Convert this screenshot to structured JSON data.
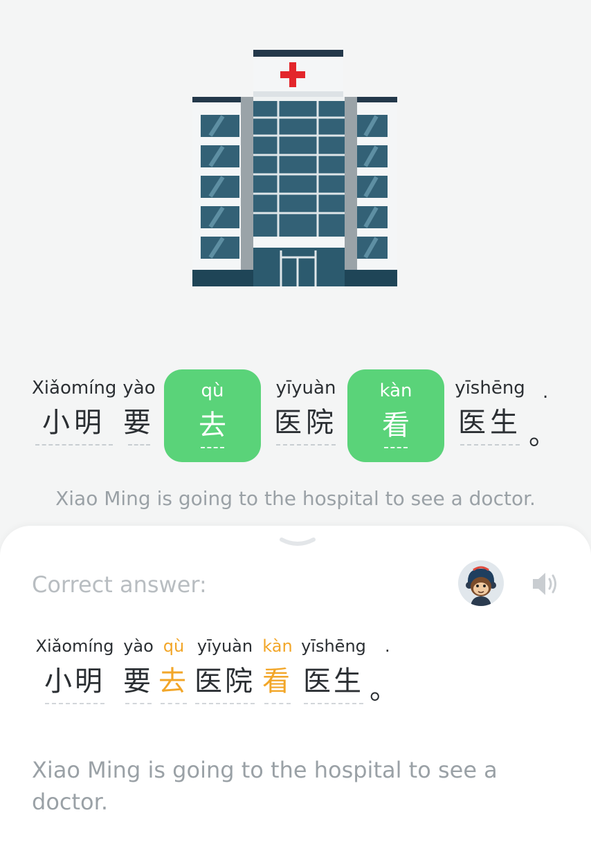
{
  "sentence": {
    "words": [
      {
        "pinyin": "Xiǎomíng",
        "hanzi": "小明"
      },
      {
        "pinyin": "yào",
        "hanzi": "要"
      },
      {
        "pinyin": "qù",
        "hanzi": "去",
        "selected": true
      },
      {
        "pinyin": "yīyuàn",
        "hanzi": "医院"
      },
      {
        "pinyin": "kàn",
        "hanzi": "看",
        "selected": true
      },
      {
        "pinyin": "yīshēng",
        "hanzi": "医生"
      }
    ],
    "period_pinyin": ".",
    "period_hanzi": "。"
  },
  "translation": "Xiao Ming is going to the hospital to see a doctor.",
  "answer": {
    "label": "Correct answer:",
    "words": [
      {
        "pinyin": "Xiǎomíng",
        "hanzi": "小明"
      },
      {
        "pinyin": "yào",
        "hanzi": "要"
      },
      {
        "pinyin": "qù",
        "hanzi": "去",
        "highlight": true
      },
      {
        "pinyin": "yīyuàn",
        "hanzi": "医院"
      },
      {
        "pinyin": "kàn",
        "hanzi": "看",
        "highlight": true
      },
      {
        "pinyin": "yīshēng",
        "hanzi": "医生"
      }
    ],
    "period_pinyin": ".",
    "period_hanzi": "。",
    "translation": "Xiao Ming is going to the hospital to see a doctor."
  },
  "icons": {
    "hero": "hospital-building-icon",
    "handle": "chevron-down-icon",
    "avatar": "monkey-avatar-icon",
    "audio": "speaker-icon"
  },
  "colors": {
    "chip": "#5ad379",
    "highlight": "#f2a628",
    "cross": "#e3262b"
  }
}
